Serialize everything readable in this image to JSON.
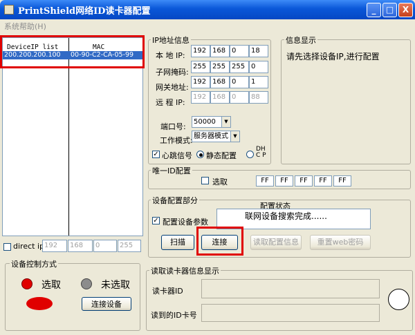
{
  "window": {
    "title": "PrintShield网络ID读卡器配置",
    "minimize": "_",
    "maximize": "□",
    "close": "X"
  },
  "menu": {
    "items": [
      "系统帮助(H)"
    ]
  },
  "device_list": {
    "columns": [
      "DeviceIP list",
      "MAC"
    ],
    "rows": [
      {
        "ip": "200.200.200.100",
        "mac": "00-90-C2-CA-05-99"
      }
    ]
  },
  "direct_ip": {
    "label": "direct ip",
    "octets": [
      "192",
      "168",
      "0",
      "255"
    ]
  },
  "control": {
    "legend": "设备控制方式",
    "selected_label": "选取",
    "unselected_label": "未选取",
    "connect_button": "连接设备"
  },
  "ip_info": {
    "legend": "IP地址信息",
    "local_ip_label": "本 地 IP:",
    "local_ip": [
      "192",
      "168",
      "0",
      "18"
    ],
    "subnet_label": "子网掩码:",
    "subnet": [
      "255",
      "255",
      "255",
      "0"
    ],
    "gateway_label": "网关地址:",
    "gateway": [
      "192",
      "168",
      "0",
      "1"
    ],
    "remote_ip_label": "远 程 IP:",
    "remote_ip": [
      "192",
      "168",
      "0",
      "88"
    ],
    "port_label": "端口号:",
    "port": "50000",
    "mode_label": "工作模式:",
    "mode": "服务器模式",
    "heartbeat_label": "心跳信号",
    "static_label": "静态配置",
    "dhcp_label": "DHC P"
  },
  "info_display": {
    "legend": "信息显示",
    "message": "请先选择设备IP,进行配置"
  },
  "unique_id": {
    "legend": "唯一ID配置",
    "select_label": "选取",
    "bytes": [
      "FF",
      "FF",
      "FF",
      "FF",
      "FF"
    ]
  },
  "config": {
    "legend": "设备配置部分",
    "status_title": "配置状态",
    "status_text": "联网设备搜索完成......",
    "config_params_label": "配置设备参数",
    "scan_button": "扫描",
    "connect_button": "连接",
    "read_config_button": "读取配置信息",
    "reset_web_button": "重置web密码"
  },
  "reader": {
    "legend": "读取读卡器信息显示",
    "reader_id_label": "读卡器ID",
    "card_id_label": "读到的ID卡号"
  },
  "colors": {
    "title_bar": "#0a57d8",
    "highlight_red": "#e00000",
    "selected_red": "#e00000",
    "unselected_gray": "#8c8c8c",
    "selection_blue": "#316ac5"
  }
}
